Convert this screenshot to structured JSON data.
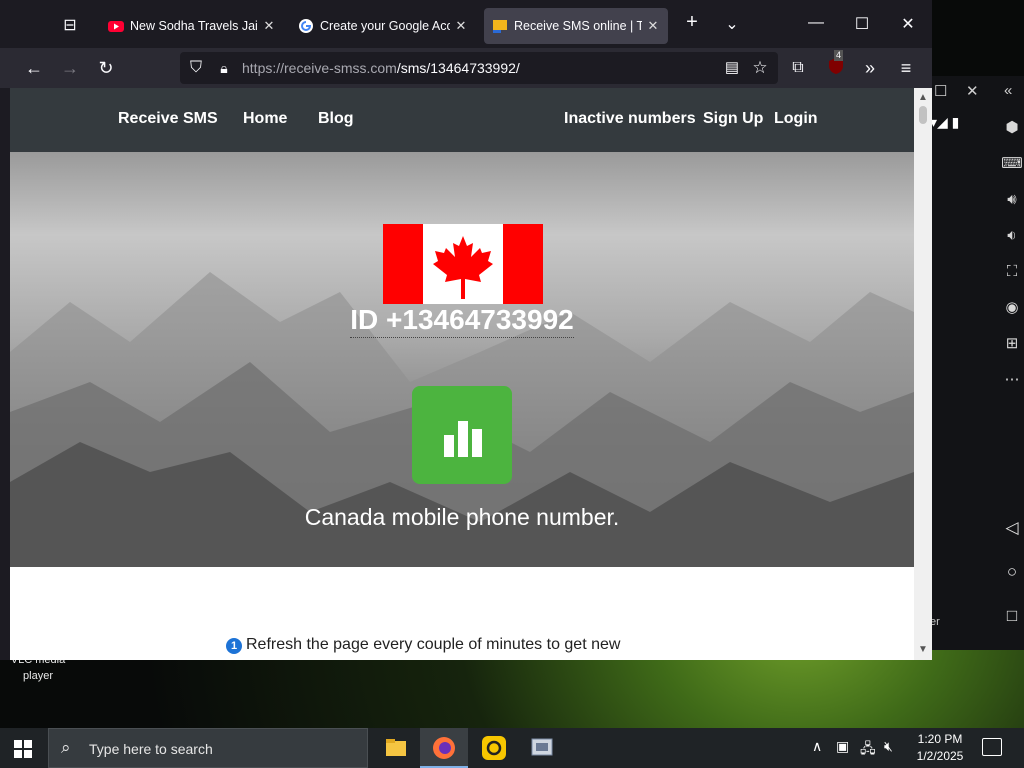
{
  "browser": {
    "tabs": [
      {
        "title": "New Sodha Travels Jaisalm",
        "favicon": "youtube-icon",
        "active": false
      },
      {
        "title": "Create your Google Accou",
        "favicon": "google-icon",
        "active": false
      },
      {
        "title": "Receive SMS online | Tem",
        "favicon": "receive-smss-icon",
        "active": true
      }
    ],
    "url_host": "https://receive-smss.com",
    "url_path": "/sms/13464733992/",
    "extension_badge": "4"
  },
  "site": {
    "nav": {
      "brand": "Receive SMS",
      "home": "Home",
      "blog": "Blog",
      "inactive": "Inactive numbers",
      "signup": "Sign Up",
      "login": "Login"
    },
    "hero": {
      "phone_id": "ID +13464733992",
      "subtitle": "Canada mobile phone number."
    },
    "notice": {
      "icon_text": "1",
      "text": "Refresh the page every couple of minutes to get new"
    }
  },
  "desktop": {
    "vlc_label_line1": "VLC media",
    "vlc_label_line2": "player",
    "emulator_fragment": "er"
  },
  "taskbar": {
    "search_placeholder": "Type here to search",
    "time": "1:20 PM",
    "date": "1/2/2025"
  },
  "colors": {
    "site_nav_bg": "#343a3e",
    "stats_green": "#4cb43f",
    "flag_red": "#ff0000",
    "active_tab": "#42414d"
  }
}
